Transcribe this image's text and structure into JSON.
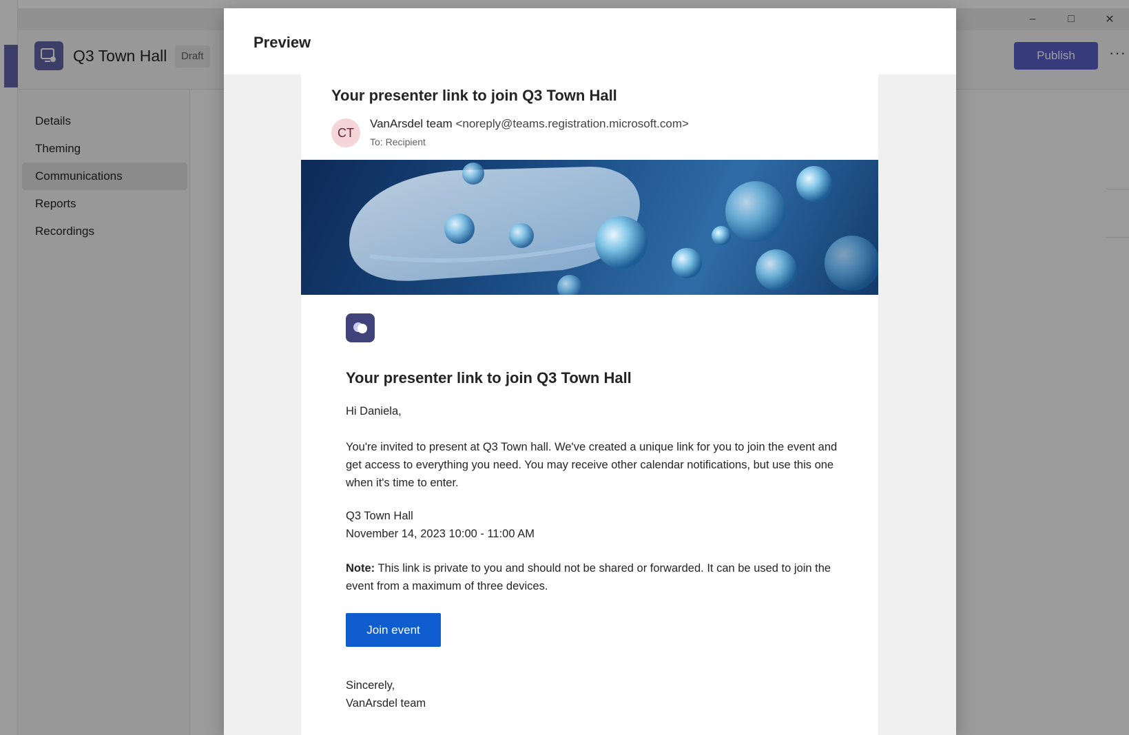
{
  "app": {
    "title": "Q3 Town Hall",
    "status_badge": "Draft",
    "publish_label": "Publish",
    "more_label": "···",
    "window_controls": [
      "–",
      "□",
      "✕"
    ]
  },
  "sidebar": {
    "items": [
      {
        "label": "Details",
        "selected": false
      },
      {
        "label": "Theming",
        "selected": false
      },
      {
        "label": "Communications",
        "selected": true
      },
      {
        "label": "Reports",
        "selected": false
      },
      {
        "label": "Recordings",
        "selected": false
      }
    ]
  },
  "dialog": {
    "title": "Preview"
  },
  "email": {
    "subject": "Your presenter link to join Q3 Town Hall",
    "avatar_initials": "CT",
    "sender_name": "VanArsdel team",
    "sender_address": "<noreply@teams.registration.microsoft.com>",
    "to_line": "To: Recipient",
    "heading": "Your presenter link to join Q3 Town Hall",
    "greeting": "Hi Daniela,",
    "body": "You're invited to present at Q3 Town hall. We've created a unique link for you to join the event and get access to everything you need. You may receive other calendar notifications, but use this one when it's time to enter.",
    "event_name": "Q3 Town Hall",
    "event_time": "November 14, 2023 10:00 - 11:00 AM",
    "note_label": "Note:",
    "note_text": "This link is private to you and should not be shared or forwarded. It can be used to join the event from a maximum of three devices.",
    "join_label": "Join event",
    "signoff": "Sincerely,",
    "signature": "VanArsdel team"
  },
  "colors": {
    "brand": "#6264a7",
    "publish": "#5b5fc7",
    "join_button": "#0f5cce",
    "avatar_bg": "#f6d5d9"
  }
}
